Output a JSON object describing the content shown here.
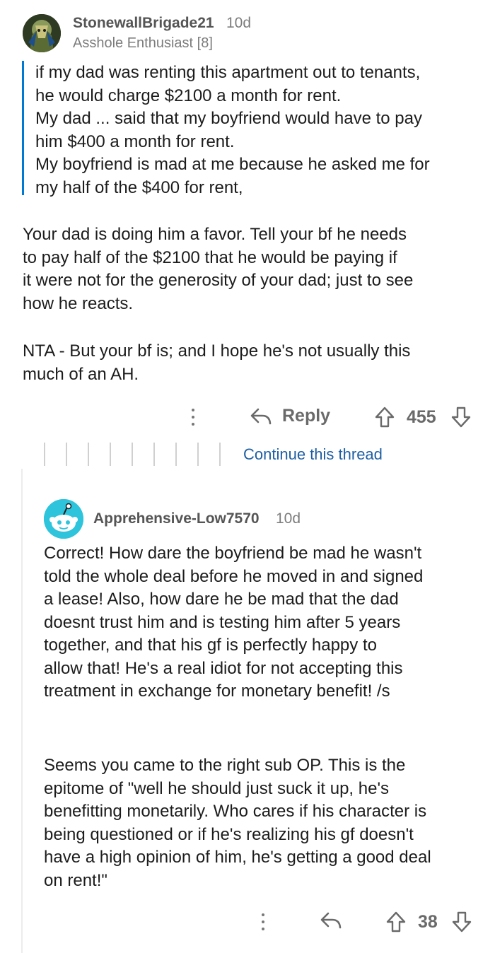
{
  "comment": {
    "username": "StonewallBrigade21",
    "time": "10d",
    "flair": "Asshole Enthusiast [8]",
    "quote_lines": [
      "if my dad was renting this apartment out to tenants,",
      "he would charge $2100 a month for rent.",
      "My dad ... said that my boyfriend would have to pay",
      "him $400 a month for rent.",
      "My boyfriend is mad at me because he asked me for",
      "my half of the $400 for rent,"
    ],
    "paragraph_1_lines": [
      "Your dad is doing him a favor. Tell your bf he needs",
      "to pay half of the $2100 that he would be paying if",
      "it were not for the generosity of your dad; just to see",
      "how he reacts."
    ],
    "paragraph_2_lines": [
      "NTA - But your bf is; and I hope he's not usually this",
      "much of an AH."
    ],
    "reply_label": "Reply",
    "score": "455",
    "continue_thread": "Continue this thread"
  },
  "reply": {
    "username": "Apprehensive-Low7570",
    "time": "10d",
    "paragraph_1_lines": [
      "Correct! How dare the boyfriend be mad he wasn't",
      "told the whole deal before he moved in and signed",
      "a lease! Also, how dare he be mad that the dad",
      "doesnt trust him and is testing him after 5 years",
      "together, and that his gf is perfectly happy to",
      "allow that! He's a real idiot for not accepting this",
      "treatment in exchange for monetary benefit! /s"
    ],
    "paragraph_2_lines": [
      "Seems you came to the right sub OP. This is the",
      "epitome of \"well he should just suck it up, he's",
      "benefitting monetarily. Who cares if his character is",
      "being questioned or if he's realizing his gf doesn't",
      "have a high opinion of him, he's getting a good deal",
      "on rent!\""
    ],
    "score": "38"
  },
  "icons": {
    "more": "more-options-icon",
    "reply": "reply-arrow-icon",
    "upvote": "upvote-arrow-icon",
    "downvote": "downvote-arrow-icon"
  },
  "colors": {
    "quote_bar": "#0079d3",
    "link": "#1e5fa3",
    "avatar2_bg": "#2ec4dc"
  }
}
